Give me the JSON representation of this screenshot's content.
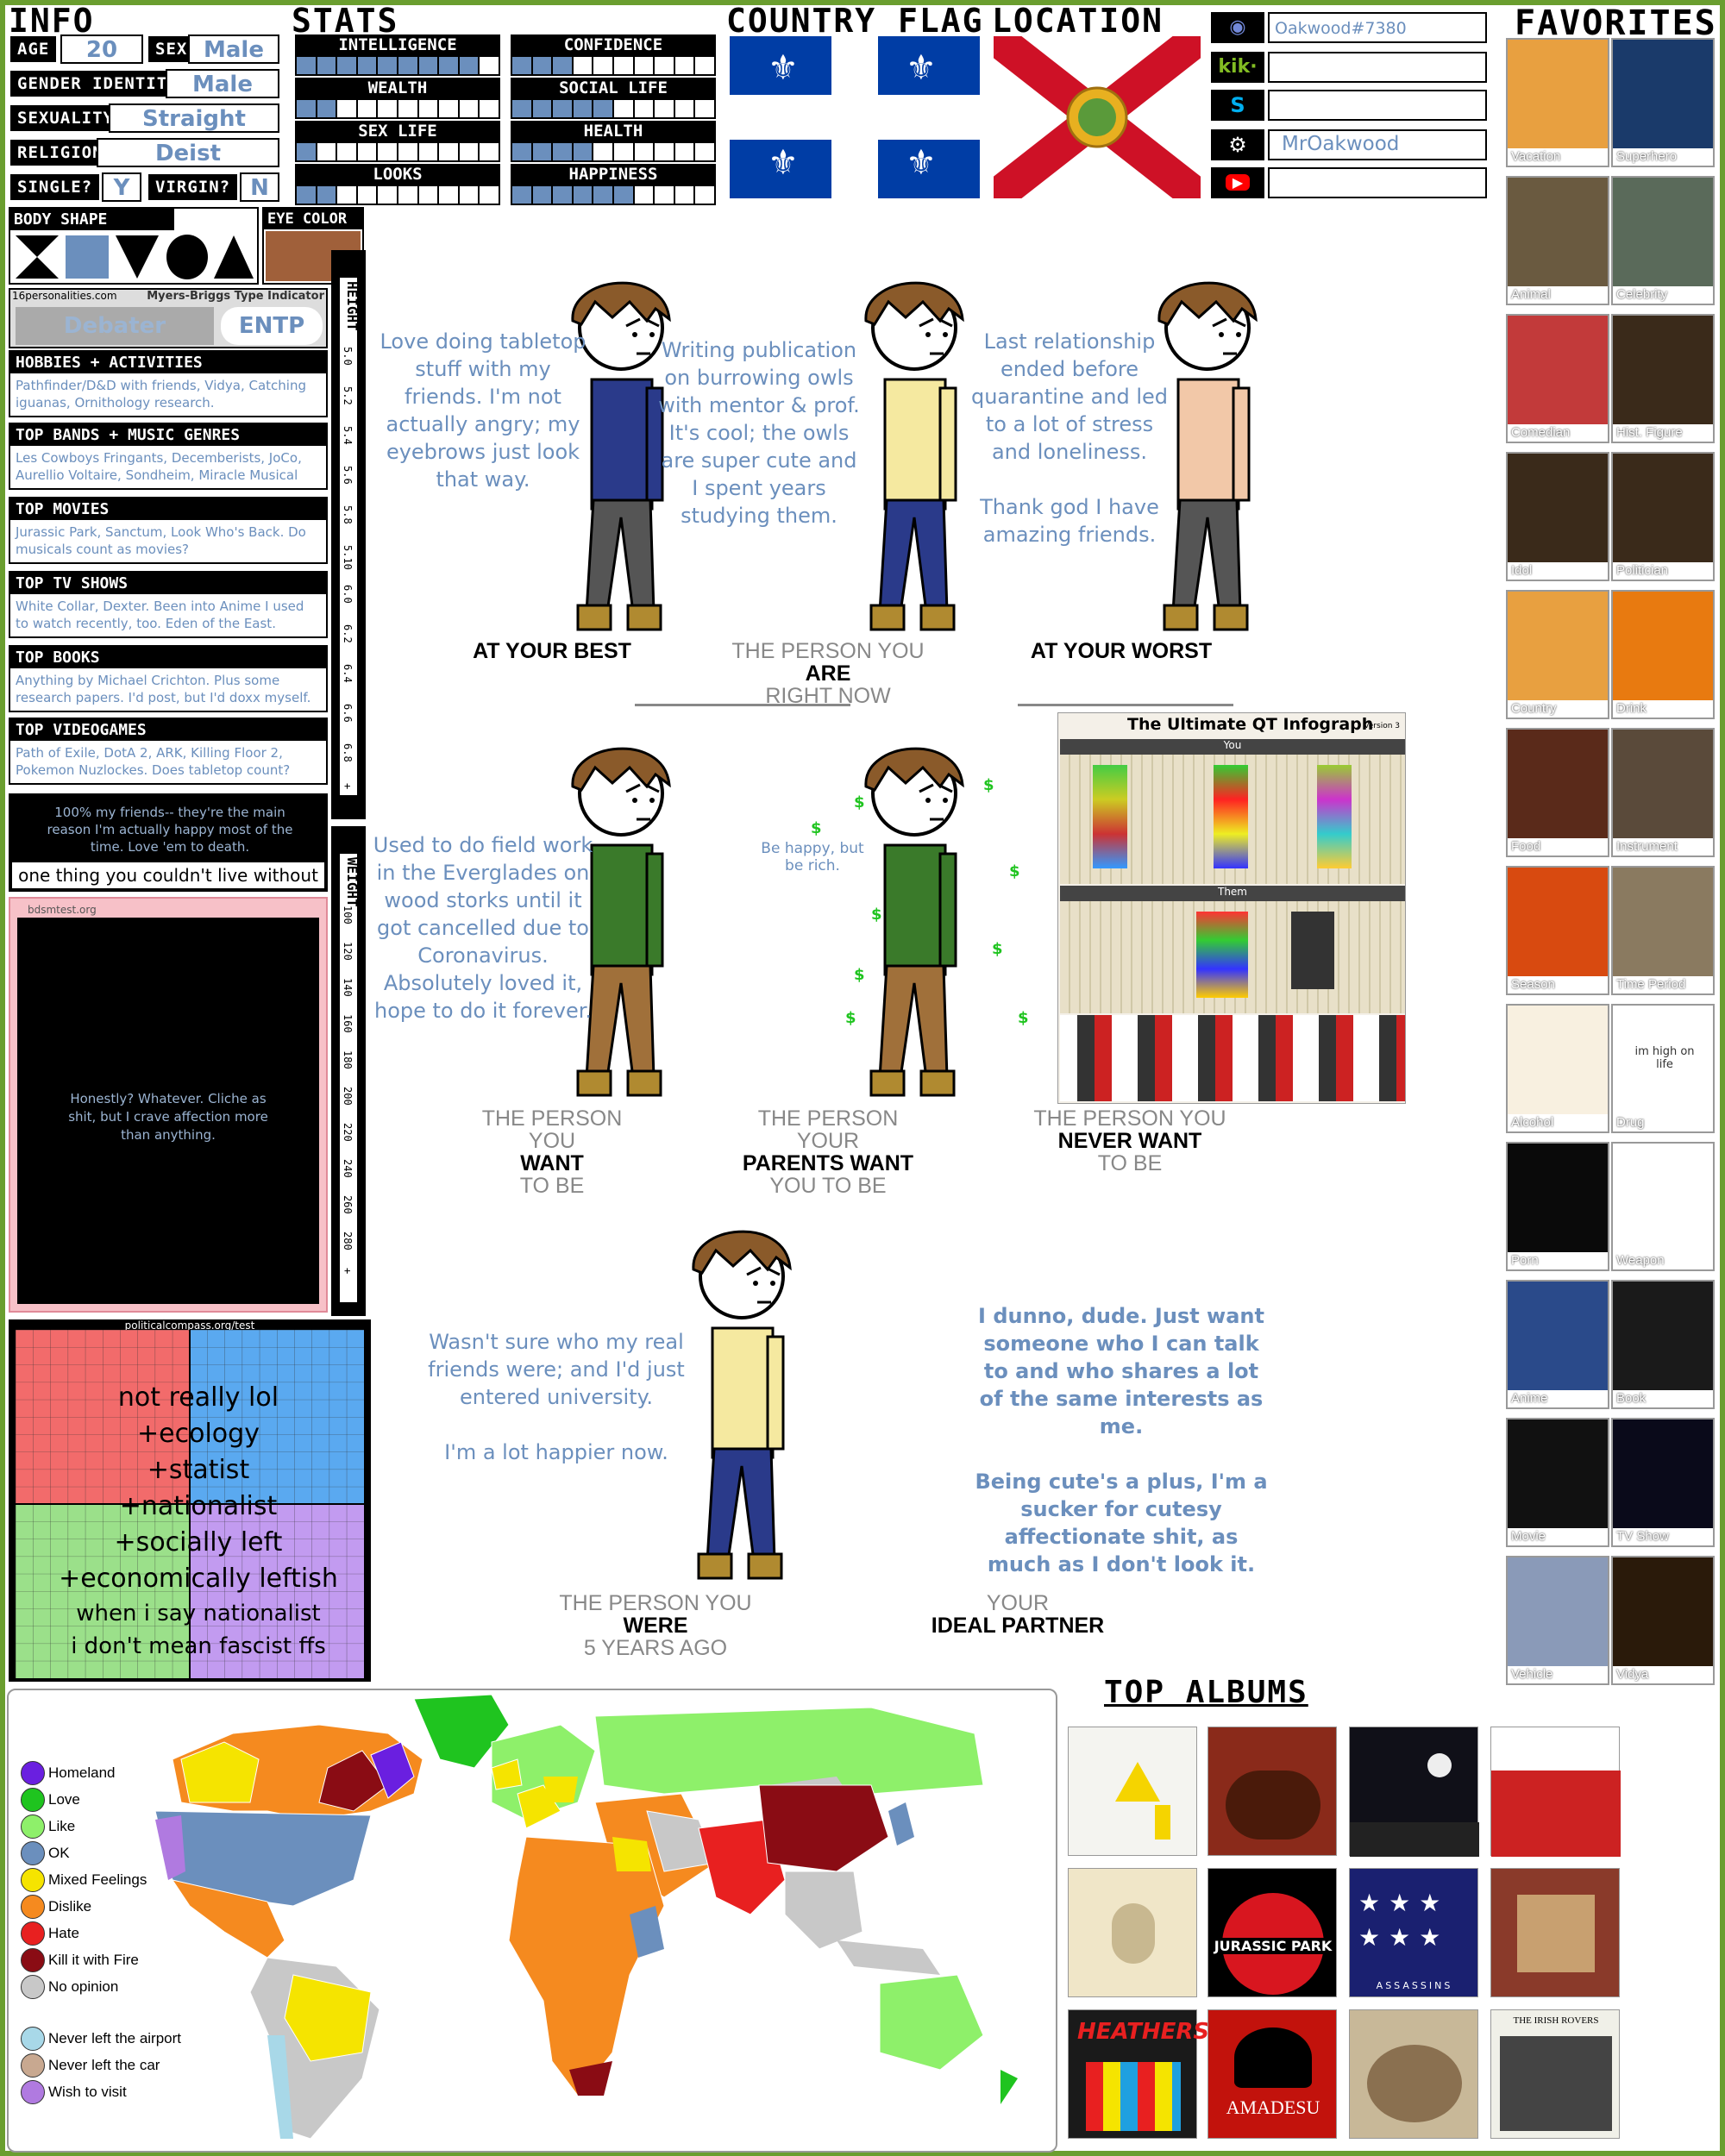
{
  "info": {
    "title": "INFO",
    "age_label": "AGE",
    "age": "20",
    "sex_label": "SEX",
    "sex": "Male",
    "gender_label": "GENDER IDENTITY",
    "gender": "Male",
    "sexuality_label": "SEXUALITY",
    "sexuality": "Straight",
    "religion_label": "RELIGION",
    "religion": "Deist",
    "single_label": "SINGLE?",
    "single": "Y",
    "virgin_label": "VIRGIN?",
    "virgin": "N"
  },
  "stats": {
    "title": "STATS",
    "items": [
      {
        "label": "INTELLIGENCE",
        "level": 0.9
      },
      {
        "label": "CONFIDENCE",
        "level": 0.3
      },
      {
        "label": "WEALTH",
        "level": 0.2
      },
      {
        "label": "SOCIAL LIFE",
        "level": 0.5
      },
      {
        "label": "SEX LIFE",
        "level": 0.1
      },
      {
        "label": "HEALTH",
        "level": 0.4
      },
      {
        "label": "LOOKS",
        "level": 0.2
      },
      {
        "label": "HAPPINESS",
        "level": 0.6
      }
    ]
  },
  "flags": {
    "country_title": "COUNTRY FLAG",
    "location_title": "LOCATION",
    "country_color": "#003DA5",
    "location_color": "#CE1126"
  },
  "social": {
    "discord": "Oakwood#7380",
    "kik": "",
    "skype": "",
    "steam": "MrOakwood",
    "youtube": ""
  },
  "favorites": {
    "title": "FAVORITES",
    "items": [
      "Vacation",
      "Superhero",
      "Animal",
      "Celebrity",
      "Comedian",
      "Hist. Figure",
      "Idol",
      "Politician",
      "Country",
      "Drink",
      "Food",
      "Instrument",
      "Season",
      "Time Period",
      "Alcohol",
      "Drug",
      "Porn",
      "Weapon",
      "Anime",
      "Book",
      "Movie",
      "TV Show",
      "Vehicle",
      "Vidya"
    ],
    "drug_text": "im high on life"
  },
  "body": {
    "shape_title": "BODY SHAPE",
    "eye_title": "EYE COLOR",
    "eye_color": "#a0603a"
  },
  "mbti": {
    "source": "16personalities.com",
    "title": "Myers-Briggs Type Indicator",
    "type_name": "Debater",
    "type_code": "ENTP"
  },
  "height": {
    "title": "HEIGHT",
    "ticks": [
      "5.0",
      "5.2",
      "5.4",
      "5.6",
      "5.8",
      "5.10",
      "6.0",
      "6.2",
      "6.4",
      "6.6",
      "6.8",
      "+"
    ]
  },
  "weight": {
    "title": "WEIGHT",
    "ticks": [
      "100",
      "120",
      "140",
      "160",
      "180",
      "200",
      "220",
      "240",
      "260",
      "280",
      "+"
    ]
  },
  "categories": [
    {
      "title": "HOBBIES + ACTIVITIES",
      "text": "Pathfinder/D&D with friends, Vidya, Catching iguanas, Ornithology research."
    },
    {
      "title": "TOP BANDS + MUSIC GENRES",
      "text": "Les Cowboys Fringants, Decemberists, JoCo, Aurellio Voltaire, Sondheim, Miracle Musical"
    },
    {
      "title": "TOP MOVIES",
      "text": "Jurassic Park, Sanctum, Look Who's Back. Do musicals count as movies?"
    },
    {
      "title": "TOP TV SHOWS",
      "text": "White Collar, Dexter. Been into Anime I used to watch recently, too. Eden of the East."
    },
    {
      "title": "TOP BOOKS",
      "text": "Anything by Michael Crichton. Plus some research papers. I'd post, but I'd doxx myself."
    },
    {
      "title": "TOP VIDEOGAMES",
      "text": "Path of Exile, DotA 2, ARK, Killing Floor 2, Pokemon Nuzlockes. Does tabletop count?"
    }
  ],
  "cant_live": {
    "text": "100% my friends-- they're the main reason I'm actually happy most of the time. Love 'em to death.",
    "label": "one thing you couldn't live without"
  },
  "bdsm": {
    "source": "bdsmtest.org",
    "text": "Honestly? Whatever. Cliche as shit, but I crave affection more than anything."
  },
  "compass": {
    "source": "politicalcompass.org/test",
    "lines": [
      "not really lol",
      "+ecology",
      "+statist",
      "+nationalist",
      "+socially left",
      "+economically leftish",
      "when i say nationalist",
      "i don't mean fascist ffs"
    ]
  },
  "persons": [
    {
      "bubble": "Love doing tabletop stuff with my friends. I'm not actually angry; my eyebrows just look that way.",
      "cap": [
        "",
        "AT YOUR BEST",
        ""
      ]
    },
    {
      "bubble": "Writing publication on burrowing owls with mentor & prof. It's cool; the owls are super cute and I spent years studying them.",
      "cap": [
        "THE PERSON YOU",
        "ARE",
        "RIGHT NOW"
      ]
    },
    {
      "bubble": "Last relationship ended before quarantine and led to a lot of stress and loneliness.\n\nThank god I have amazing friends.",
      "cap": [
        "",
        "AT YOUR WORST",
        ""
      ]
    },
    {
      "bubble": "Used to do field work in the Everglades on wood storks until it got cancelled due to Coronavirus. Absolutely loved it, hope to do it forever.",
      "cap": [
        "THE PERSON YOU",
        "WANT",
        "TO BE"
      ]
    },
    {
      "bubble": "Be happy, but be rich.",
      "cap": [
        "THE PERSON YOUR",
        "PARENTS WANT",
        "YOU TO BE"
      ]
    },
    {
      "bubble": "",
      "cap": [
        "THE PERSON YOU",
        "NEVER WANT",
        "TO BE"
      ]
    },
    {
      "bubble": "Wasn't sure who my real friends were; and I'd just entered university.\n\nI'm a lot happier now.",
      "cap": [
        "THE PERSON YOU",
        "WERE",
        "5 YEARS AGO"
      ]
    },
    {
      "bubble": "I dunno, dude. Just want someone who I can talk to and who shares a lot of the same interests as me.\n\nBeing cute's a plus, I'm a sucker for cutesy affectionate shit, as much as I don't look it.",
      "cap": [
        "YOUR",
        "IDEAL PARTNER",
        ""
      ]
    }
  ],
  "infograph": {
    "title": "The Ultimate QT Infograph",
    "version": "Version 3",
    "you": "You",
    "them": "Them"
  },
  "map": {
    "legend": [
      {
        "label": "Homeland",
        "color": "#6a1fe0"
      },
      {
        "label": "Love",
        "color": "#1fc41f"
      },
      {
        "label": "Like",
        "color": "#8ef06a"
      },
      {
        "label": "OK",
        "color": "#6b8fbd"
      },
      {
        "label": "Mixed Feelings",
        "color": "#f5e400"
      },
      {
        "label": "Dislike",
        "color": "#f58a1f"
      },
      {
        "label": "Hate",
        "color": "#e82020"
      },
      {
        "label": "Kill it with Fire",
        "color": "#8a0c14"
      },
      {
        "label": "No opinion",
        "color": "#c8c8c8"
      },
      {
        "label": "Never left the airport",
        "color": "#a8d8e8"
      },
      {
        "label": "Never left the car",
        "color": "#c8a890"
      },
      {
        "label": "Wish to visit",
        "color": "#b07ae0"
      }
    ]
  },
  "albums": {
    "title": "TOP ALBUMS",
    "jurassic": "JURASSIC PARK",
    "amadeus": "AMADESU",
    "heathers": "HEATHERS",
    "assassins": "ASSASSINS",
    "irish": "THE IRISH ROVERS"
  }
}
